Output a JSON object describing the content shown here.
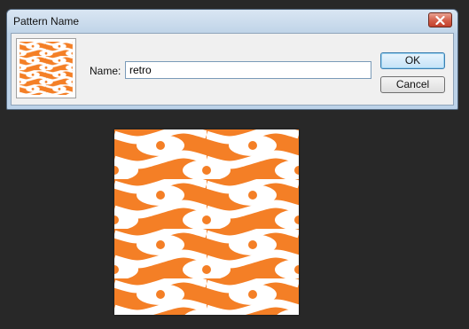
{
  "dialog": {
    "title": "Pattern Name",
    "name_label": "Name:",
    "name_value": "retro",
    "ok_label": "OK",
    "cancel_label": "Cancel"
  },
  "pattern": {
    "background_color": "#f47f26",
    "motif_color": "#ffffff"
  },
  "icons": {
    "close": "close-icon"
  }
}
